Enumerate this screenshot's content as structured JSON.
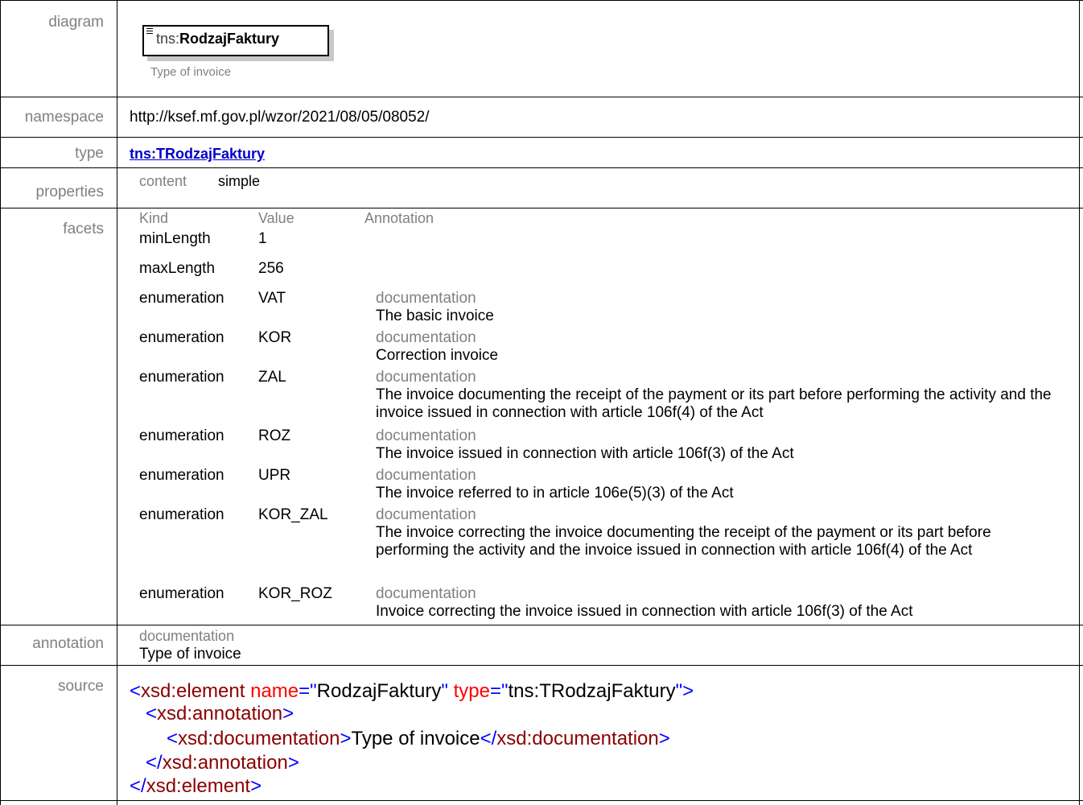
{
  "labels": {
    "diagram": "diagram",
    "namespace": "namespace",
    "type": "type",
    "properties": "properties",
    "facets": "facets",
    "annotation": "annotation",
    "source": "source"
  },
  "diagram": {
    "prefix": "tns:",
    "name": "RodzajFaktury",
    "caption": "Type of invoice"
  },
  "namespace": "http://ksef.mf.gov.pl/wzor/2021/08/05/08052/",
  "type": "tns:TRodzajFaktury",
  "properties": {
    "key": "content",
    "value": "simple"
  },
  "facets": {
    "headers": {
      "kind": "Kind",
      "value": "Value",
      "annotation": "Annotation"
    },
    "rows": [
      {
        "kind": "minLength",
        "value": "1",
        "doc_label": "",
        "doc": ""
      },
      {
        "kind": "maxLength",
        "value": "256",
        "doc_label": "",
        "doc": ""
      },
      {
        "kind": "enumeration",
        "value": "VAT",
        "doc_label": "documentation",
        "doc": "The basic invoice"
      },
      {
        "kind": "enumeration",
        "value": "KOR",
        "doc_label": "documentation",
        "doc": "Correction invoice"
      },
      {
        "kind": "enumeration",
        "value": "ZAL",
        "doc_label": "documentation",
        "doc": "The invoice documenting the receipt of the payment or its part before performing the activity and the invoice issued in connection with article 106f(4) of the Act"
      },
      {
        "kind": "enumeration",
        "value": "ROZ",
        "doc_label": "documentation",
        "doc": "The invoice issued in connection with article 106f(3) of the Act"
      },
      {
        "kind": "enumeration",
        "value": "UPR",
        "doc_label": "documentation",
        "doc": "The invoice referred to in article 106e(5)(3) of the Act"
      },
      {
        "kind": "enumeration",
        "value": "KOR_ZAL",
        "doc_label": "documentation",
        "doc": "The invoice correcting the invoice documenting the receipt of the payment or its part before performing the activity and the invoice issued in connection with article 106f(4) of the Act"
      },
      {
        "kind": "enumeration",
        "value": "KOR_ROZ",
        "doc_label": "documentation",
        "doc": "Invoice correcting the invoice issued in connection with article 106f(3) of the Act"
      }
    ]
  },
  "annotation": {
    "label": "documentation",
    "text": "Type of invoice"
  },
  "source": {
    "l1_open": "<",
    "l1_tag": "xsd:element",
    "l1_attr1": " name",
    "l1_eq1": "=\"",
    "l1_val1": "RodzajFaktury",
    "l1_q1": "\"",
    "l1_attr2": " type",
    "l1_eq2": "=\"",
    "l1_val2": "tns:TRodzajFaktury",
    "l1_close": "\">",
    "l2_open": "<",
    "l2_tag": "xsd:annotation",
    "l2_close": ">",
    "l3_open": "<",
    "l3_tag": "xsd:documentation",
    "l3_close": ">",
    "l3_text": "Type of invoice",
    "l3_endopen": "</",
    "l3_endtag": "xsd:documentation",
    "l3_endclose": ">",
    "l4_open": "</",
    "l4_tag": "xsd:annotation",
    "l4_close": ">",
    "l5_open": "</",
    "l5_tag": "xsd:element",
    "l5_close": ">"
  }
}
